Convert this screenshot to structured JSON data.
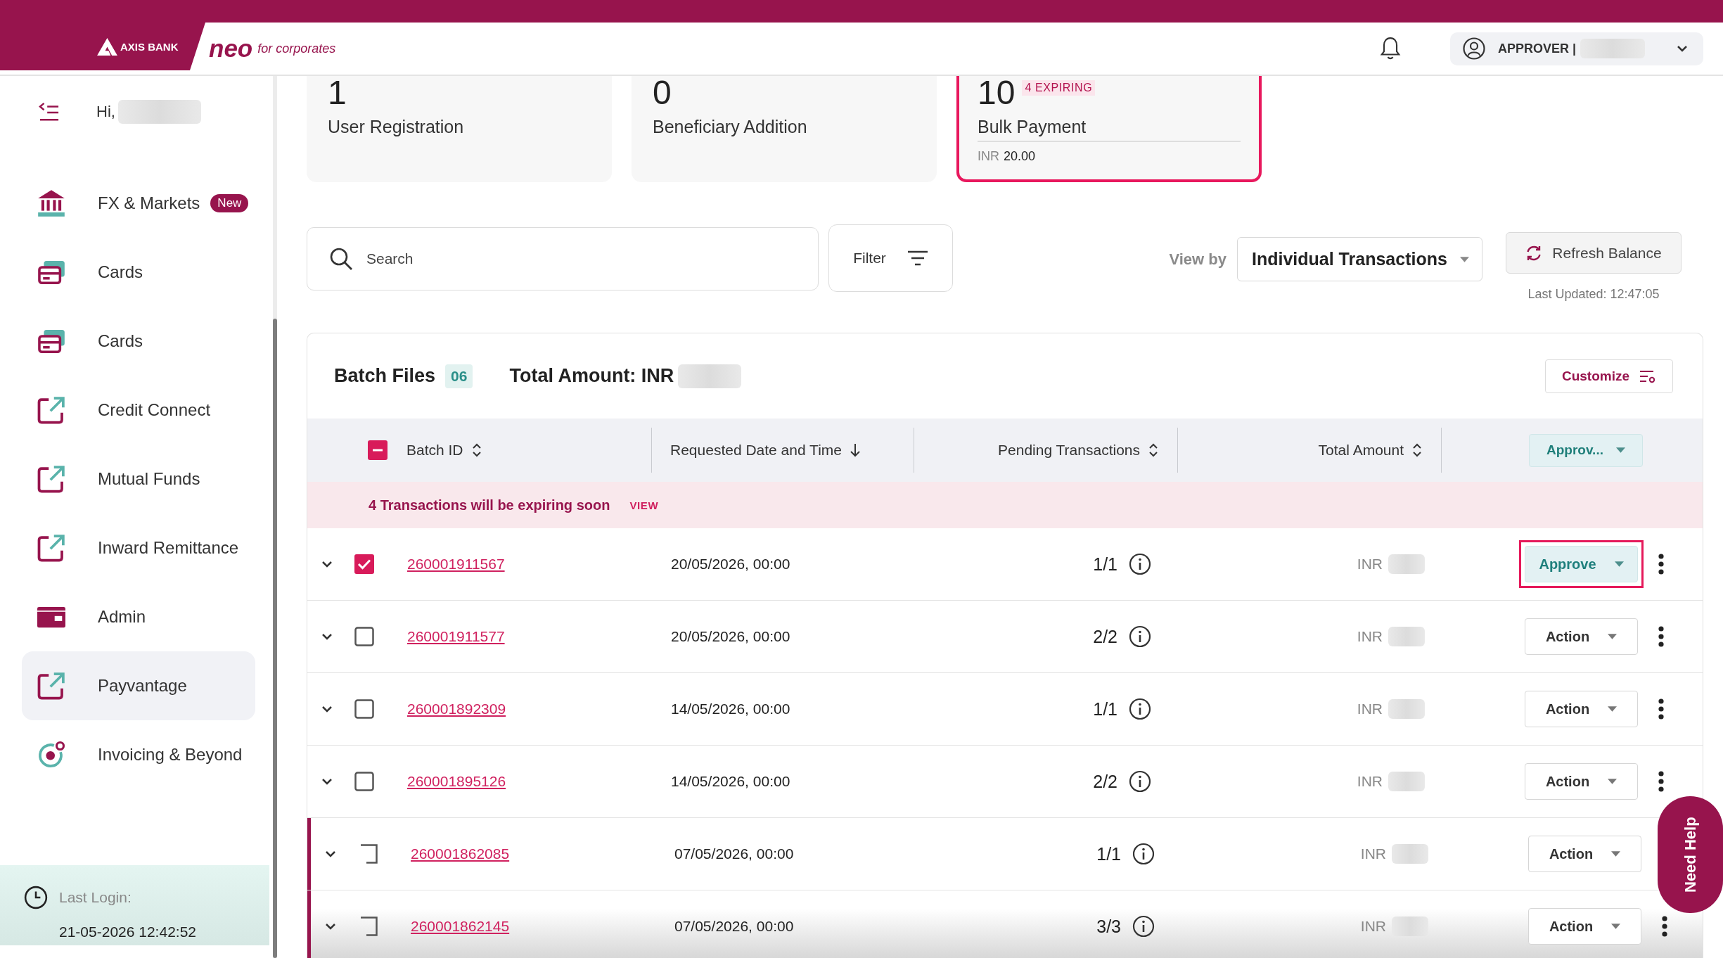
{
  "header": {
    "bank_name": "AXIS BANK",
    "product_name": "neo",
    "tagline": "for corporates",
    "user_role": "APPROVER |"
  },
  "sidebar": {
    "greeting": "Hi,",
    "items": [
      {
        "kind": "markets",
        "label": "FX & Markets",
        "badge": "New",
        "selected": false
      },
      {
        "kind": "cards",
        "label": "Cards",
        "selected": false
      },
      {
        "kind": "cards",
        "label": "Cards",
        "selected": false
      },
      {
        "kind": "external",
        "label": "Credit Connect",
        "selected": false
      },
      {
        "kind": "external",
        "label": "Mutual Funds",
        "selected": false
      },
      {
        "kind": "external",
        "label": "Inward Remittance",
        "selected": false
      },
      {
        "kind": "admin",
        "label": "Admin",
        "selected": false
      },
      {
        "kind": "external",
        "label": "Payvantage",
        "selected": true
      },
      {
        "kind": "invoicing",
        "label": "Invoicing & Beyond",
        "selected": false
      }
    ],
    "last_login": {
      "label": "Last Login:",
      "value": "21-05-2026 12:42:52"
    }
  },
  "summary_cards": [
    {
      "count": "1",
      "label": "User Registration",
      "selected": false
    },
    {
      "count": "0",
      "label": "Beneficiary Addition",
      "selected": false
    },
    {
      "count": "10",
      "badge": "4 EXPIRING",
      "label": "Bulk Payment",
      "currency": "INR",
      "amount": "20.00",
      "selected": true
    }
  ],
  "toolbar": {
    "search": {
      "placeholder": "Search"
    },
    "filter": "Filter",
    "view_by": {
      "label": "View by",
      "value": "Individual Transactions"
    },
    "refresh": {
      "label": "Refresh Balance",
      "last_updated": "Last Updated: 12:47:05"
    }
  },
  "table": {
    "title": "Batch Files",
    "count": "06",
    "total_label": "Total Amount: INR",
    "customize": "Customize",
    "select_all": {
      "indeterminate": true
    },
    "columns": [
      {
        "label": "Batch ID",
        "sorted": false
      },
      {
        "label": "Requested Date and Time",
        "sorted": true
      },
      {
        "label": "Pending Transactions",
        "sorted": false
      },
      {
        "label": "Total Amount",
        "sorted": false
      }
    ],
    "bulk_action": {
      "label": "Approv...",
      "chosen": true
    },
    "notice": {
      "text": "4 Transactions will be expiring soon",
      "link": "VIEW"
    },
    "rows": [
      {
        "batch_id": "260001911567",
        "requested": "20/05/2026, 00:00",
        "pending": "1/1",
        "currency": "INR",
        "action": "Approve",
        "action_chosen": true,
        "checked": true,
        "highlighted": true,
        "expiring": false,
        "menu_button": true
      },
      {
        "batch_id": "260001911577",
        "requested": "20/05/2026, 00:00",
        "pending": "2/2",
        "currency": "INR",
        "action": "Action",
        "action_chosen": false,
        "checked": false,
        "highlighted": false,
        "expiring": false,
        "menu_button": true
      },
      {
        "batch_id": "260001892309",
        "requested": "14/05/2026, 00:00",
        "pending": "1/1",
        "currency": "INR",
        "action": "Action",
        "action_chosen": false,
        "checked": false,
        "highlighted": false,
        "expiring": false,
        "menu_button": true
      },
      {
        "batch_id": "260001895126",
        "requested": "14/05/2026, 00:00",
        "pending": "2/2",
        "currency": "INR",
        "action": "Action",
        "action_chosen": false,
        "checked": false,
        "highlighted": false,
        "expiring": false,
        "menu_button": true
      },
      {
        "batch_id": "260001862085",
        "requested": "07/05/2026, 00:00",
        "pending": "1/1",
        "currency": "INR",
        "action": "Action",
        "action_chosen": false,
        "checked": false,
        "highlighted": false,
        "expiring": true,
        "menu_button": false
      },
      {
        "batch_id": "260001862145",
        "requested": "07/05/2026, 00:00",
        "pending": "3/3",
        "currency": "INR",
        "action": "Action",
        "action_chosen": false,
        "checked": false,
        "highlighted": false,
        "expiring": true,
        "menu_button": true
      }
    ]
  },
  "help_button": "Need Help"
}
